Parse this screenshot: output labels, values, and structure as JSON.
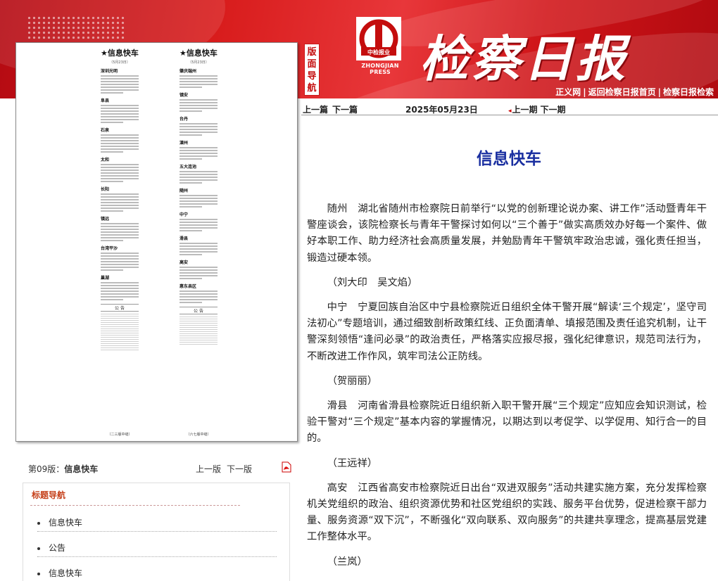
{
  "header": {
    "nav_vertical": "版面导航",
    "logo_badge": "中检报业",
    "logo_press": "ZHONGJIAN PRESS",
    "masthead": "检察日报",
    "links": [
      "正义网",
      "返回检察日报首页",
      "检察日报检索"
    ],
    "link_sep": "|"
  },
  "subnav": {
    "prev_article": "上一篇",
    "next_article": "下一篇",
    "date": "2025年05月23日",
    "prev_issue": "上一期",
    "next_issue": "下一期"
  },
  "preview": {
    "col1": {
      "title": "★信息快车",
      "date": "（5月23日）",
      "items": [
        "深圳光明",
        "阜县",
        "石泉",
        "太和",
        "长阳",
        "镇远",
        "台湾平沙",
        "巢湖"
      ],
      "notice": "公 告",
      "footer": "（二三版中缝）"
    },
    "col2": {
      "title": "★信息快车",
      "date": "（5月23日）",
      "items": [
        "肇庆端州",
        "镇安",
        "台丹",
        "溧州",
        "五大连池",
        "随州",
        "中宁",
        "滑县",
        "高安",
        "惠东县区"
      ],
      "notice": "公 告",
      "footer": "（六七版中缝）"
    }
  },
  "page_info": {
    "prefix": "第09版：",
    "name": "信息快车",
    "prev_page": "上一版",
    "next_page": "下一版"
  },
  "toc": {
    "title": "标题导航",
    "items": [
      "信息快车",
      "公告",
      "信息快车"
    ]
  },
  "article": {
    "title": "信息快车",
    "paragraphs": [
      "随州　湖北省随州市检察院日前举行“以党的创新理论说办案、讲工作”活动暨青年干警座谈会，该院检察长与青年干警探讨如何以“三个善于”做实高质效办好每一个案件、做好本职工作、助力经济社会高质量发展，并勉励青年干警筑牢政治忠诚，强化责任担当，锻造过硬本领。",
      "（刘大印　吴文焰）",
      "中宁　宁夏回族自治区中宁县检察院近日组织全体干警开展“解读‘三个规定’，坚守司法初心”专题培训，通过细致剖析政策红线、正负面清单、填报范围及责任追究机制，让干警深刻领悟“逢问必录”的政治责任，严格落实应报尽报，强化纪律意识，规范司法行为，不断改进工作作风，筑牢司法公正防线。",
      "（贺丽丽）",
      "滑县　河南省滑县检察院近日组织新入职干警开展“三个规定”应知应会知识测试，检验干警对“三个规定”基本内容的掌握情况，以期达到以考促学、以学促用、知行合一的目的。",
      "（王远祥）",
      "高安　江西省高安市检察院近日出台“双进双服务”活动共建实施方案，充分发挥检察机关党组织的政治、组织资源优势和社区党组织的实践、服务平台优势，促进检察干部力量、服务资源“双下沉”，不断强化“双向联系、双向服务”的共建共享理念，提高基层党建工作整体水平。",
      "（兰岚）"
    ]
  },
  "colors": {
    "banner_red": "#d81c1c",
    "title_blue": "#1a2fa0",
    "toc_title": "#c5401a"
  }
}
